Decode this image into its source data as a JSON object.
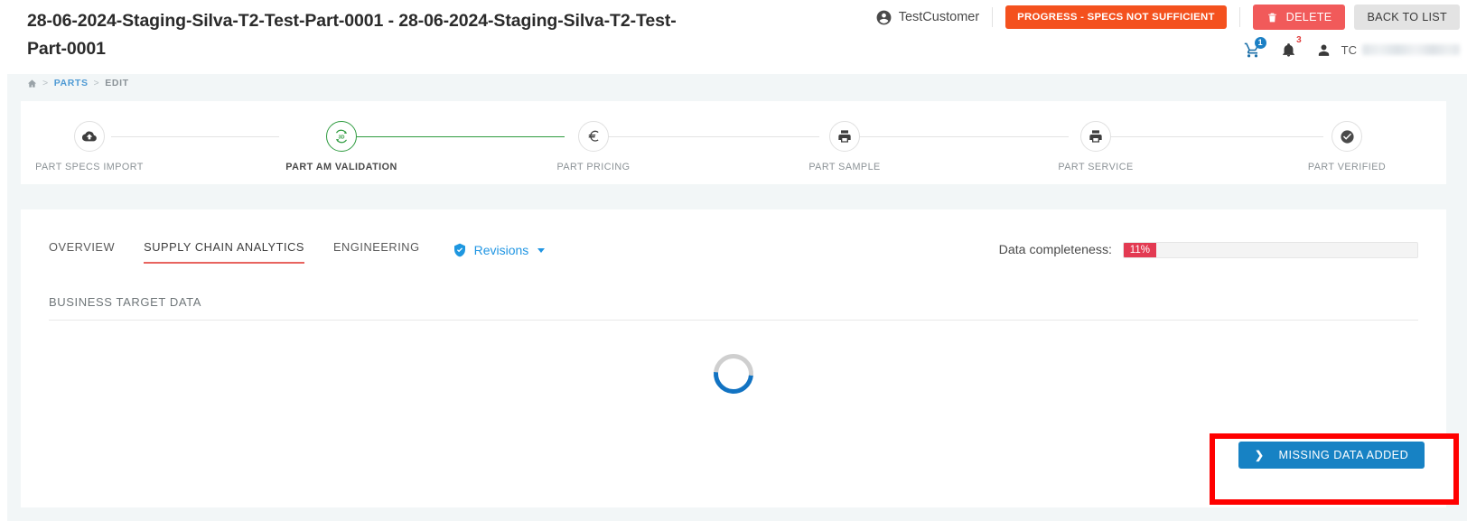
{
  "header": {
    "title": "28-06-2024-Staging-Silva-T2-Test-Part-0001 - 28-06-2024-Staging-Silva-T2-Test-Part-0001",
    "customer": "TestCustomer",
    "status_badge": "PROGRESS - SPECS NOT SUFFICIENT",
    "delete_label": "DELETE",
    "back_label": "BACK TO LIST",
    "cart_count": "1",
    "notification_count": "3",
    "user_initials": "TC",
    "colors": {
      "status_badge": "#f4511e",
      "delete": "#f15a5a",
      "back": "#e3e3e3"
    }
  },
  "breadcrumb": {
    "home": "home-icon",
    "sep": ">",
    "items": [
      {
        "label": "PARTS",
        "link": true
      },
      {
        "label": "EDIT",
        "link": false
      }
    ]
  },
  "stepper": {
    "steps": [
      {
        "label": "PART SPECS IMPORT",
        "icon": "cloud-upload-icon",
        "state": "pending"
      },
      {
        "label": "PART AM VALIDATION",
        "icon": "3d-rotate-icon",
        "state": "active"
      },
      {
        "label": "PART PRICING",
        "icon": "euro-icon",
        "state": "pending"
      },
      {
        "label": "PART SAMPLE",
        "icon": "printer-icon",
        "state": "pending"
      },
      {
        "label": "PART SERVICE",
        "icon": "printer-icon",
        "state": "pending"
      },
      {
        "label": "PART VERIFIED",
        "icon": "check-circle-icon",
        "state": "pending"
      }
    ],
    "active_color": "#2e9b3f"
  },
  "main": {
    "tabs": [
      {
        "label": "OVERVIEW",
        "active": false
      },
      {
        "label": "SUPPLY CHAIN ANALYTICS",
        "active": true
      },
      {
        "label": "ENGINEERING",
        "active": false
      }
    ],
    "revisions": {
      "label": "Revisions",
      "icon": "shield-check-icon",
      "color": "#2196e3"
    },
    "completeness": {
      "label": "Data completeness:",
      "value": "11%",
      "percent": 11,
      "color": "#e33a52"
    },
    "section_title": "BUSINESS TARGET DATA",
    "loading": true,
    "cta": {
      "label": "MISSING DATA ADDED",
      "icon": "chevron-right-icon",
      "color": "#1782c4",
      "highlight_color": "#ff0000"
    }
  }
}
